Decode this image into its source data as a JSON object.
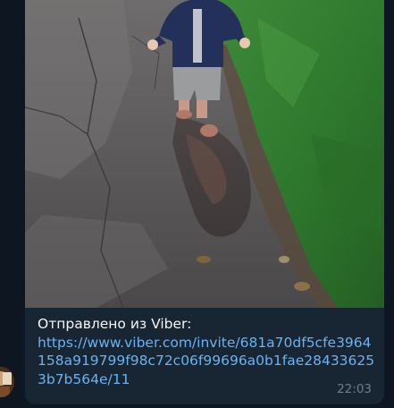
{
  "message": {
    "caption_prefix": "Отправлено из Viber:",
    "link_url": "https://www.viber.com/invite/681a70df5cfe3964158a919799f98c72c06f99696a0b1fae284336253b7b564e/11",
    "time": "22:03"
  },
  "photo": {
    "subject": "toddler-walking-in-puddle"
  },
  "colors": {
    "chat_background": "#0e1621",
    "bubble_background": "#182533",
    "link": "#6ab2f2",
    "time": "#6d7f8f"
  }
}
